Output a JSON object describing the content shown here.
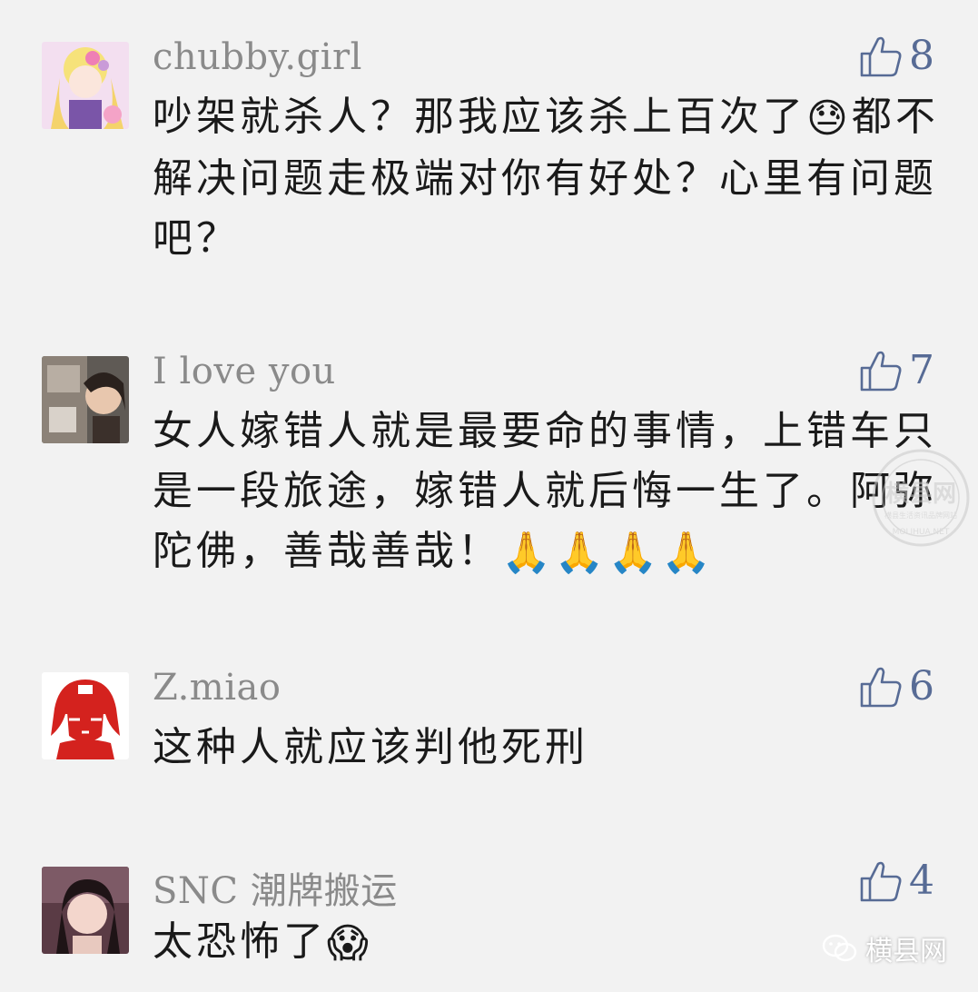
{
  "comments": [
    {
      "username": "chubby.girl",
      "likes": "8",
      "text_parts": [
        "吵架就杀人？那我应该杀上百次了",
        "都不解决问题走极端对你有好处？心里有问题吧？"
      ],
      "emoji": "😓"
    },
    {
      "username": "I love you",
      "likes": "7",
      "text": "女人嫁错人就是最要命的事情，上错车只是一段旅途，嫁错人就后悔一生了。阿弥陀佛，善哉善哉！",
      "emoji": "🙏🙏🙏🙏"
    },
    {
      "username": "Z.miao",
      "likes": "6",
      "text": "这种人就应该判他死刑"
    },
    {
      "username": "SNC 潮牌搬运",
      "likes": "4",
      "text": "太恐怖了",
      "emoji": "😱"
    }
  ],
  "watermark": {
    "title": "横县网",
    "subtitle": "横县生活资讯品牌网站",
    "url": "MOLIHUA.NET"
  },
  "brand": {
    "label": "横县网"
  },
  "colors": {
    "background": "#f2f2f2",
    "username": "#8a8a8a",
    "like_accent": "#576b95",
    "text": "#1a1a1a"
  }
}
